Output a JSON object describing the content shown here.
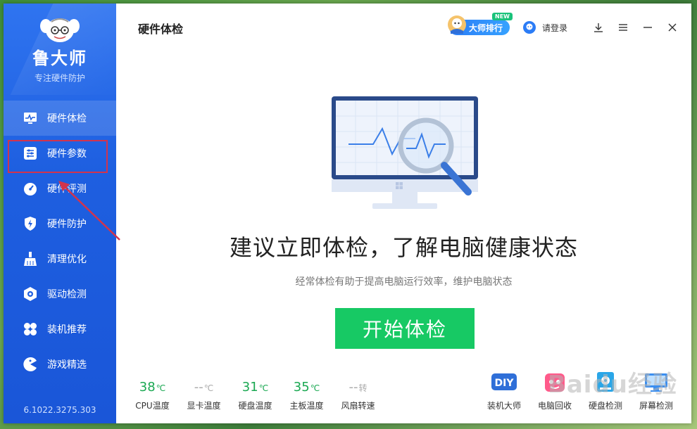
{
  "app": {
    "brand_name": "鲁大师",
    "slogan": "专注硬件防护",
    "version": "6.1022.3275.303",
    "page_title": "硬件体检"
  },
  "sidebar": {
    "items": [
      {
        "label": "硬件体检",
        "icon": "monitor-chart-icon"
      },
      {
        "label": "硬件参数",
        "icon": "sliders-icon"
      },
      {
        "label": "硬件评测",
        "icon": "speedometer-icon"
      },
      {
        "label": "硬件防护",
        "icon": "shield-bolt-icon"
      },
      {
        "label": "清理优化",
        "icon": "broom-icon"
      },
      {
        "label": "驱动检测",
        "icon": "driver-gear-icon"
      },
      {
        "label": "装机推荐",
        "icon": "clover-icon"
      },
      {
        "label": "游戏精选",
        "icon": "pacman-icon"
      }
    ],
    "active_index": 0,
    "highlighted_index": 1
  },
  "topbar": {
    "rank_label": "大师排行",
    "new_badge": "NEW",
    "login_label": "请登录"
  },
  "main": {
    "headline": "建议立即体检，了解电脑健康状态",
    "subline": "经常体检有助于提高电脑运行效率，维护电脑状态",
    "start_button": "开始体检"
  },
  "stats": [
    {
      "value": "38",
      "unit": "℃",
      "label": "CPU温度"
    },
    {
      "value": "--",
      "unit": "℃",
      "label": "显卡温度"
    },
    {
      "value": "31",
      "unit": "℃",
      "label": "硬盘温度"
    },
    {
      "value": "35",
      "unit": "℃",
      "label": "主板温度"
    },
    {
      "value": "--",
      "unit": "转",
      "label": "风扇转速"
    }
  ],
  "tools": [
    {
      "label": "装机大师",
      "icon": "diy-icon"
    },
    {
      "label": "电脑回收",
      "icon": "recycle-pc-icon"
    },
    {
      "label": "硬盘检测",
      "icon": "disk-check-icon"
    },
    {
      "label": "屏幕检测",
      "icon": "screen-check-icon"
    }
  ],
  "watermark": "Baidu经验",
  "colors": {
    "sidebar": "#1e5fe0",
    "accent_green": "#17c964",
    "highlight_red": "#d2344d"
  }
}
